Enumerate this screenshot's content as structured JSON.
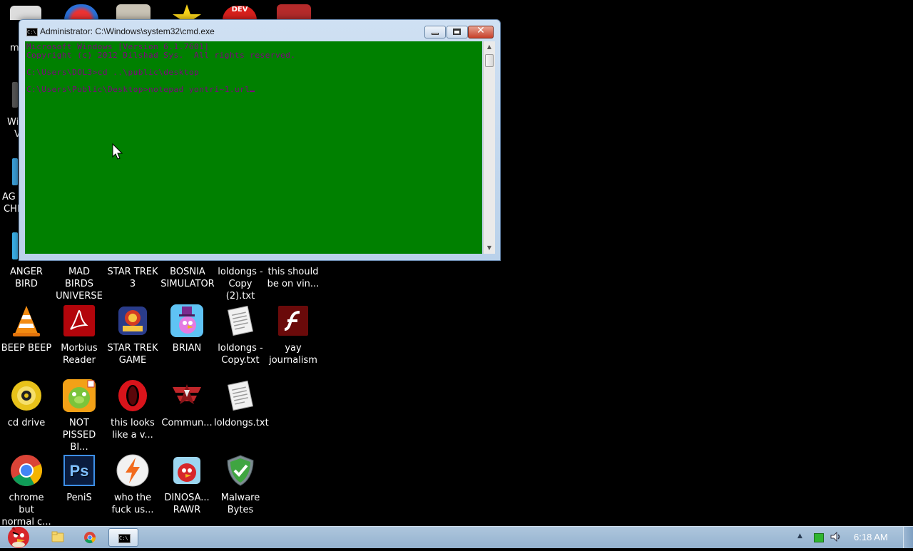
{
  "window": {
    "title": "Administrator: C:\\Windows\\system32\\cmd.exe",
    "console_lines": [
      "Microsoft Windows [Version 6.1.7601]",
      "Copyright (c) 2012 Dilshad Sys.  All rights reserved.",
      "C:\\Users\\DOL3>cd ..\\public\\desktop",
      "C:\\Users\\Public\\Desktop>notepad yontri~1.url"
    ],
    "console_bg": "#008000",
    "console_fg": "#800080"
  },
  "desktop": {
    "left_edge_labels": [
      "m",
      "Wi",
      "V",
      "AG",
      "CHI"
    ],
    "icons": [
      {
        "label": "ANGER\nBIRD",
        "icon": "orange-app-icon"
      },
      {
        "label": "MAD BIRDS\nUNIVERSE",
        "icon": "game-icon"
      },
      {
        "label": "STAR TREK\n3",
        "icon": "star-icon"
      },
      {
        "label": "BOSNIA\nSIMULATOR",
        "icon": "dev-icon"
      },
      {
        "label": "loldongs -\nCopy (2).txt",
        "icon": "text-file-icon"
      },
      {
        "label": "this should\nbe on vin...",
        "icon": "red-app-icon"
      },
      {
        "label": "BEEP BEEP",
        "icon": "vlc-cone-icon"
      },
      {
        "label": "Morbius\nReader",
        "icon": "pdf-reader-icon"
      },
      {
        "label": "STAR TREK\nGAME",
        "icon": "star-wars-game-icon"
      },
      {
        "label": "BRIAN",
        "icon": "bird-hat-icon"
      },
      {
        "label": "loldongs -\nCopy.txt",
        "icon": "text-file-icon"
      },
      {
        "label": "yay\njournalism",
        "icon": "flash-icon"
      },
      {
        "label": "cd drive",
        "icon": "cd-drive-icon"
      },
      {
        "label": "NOT\nPISSED BI...",
        "icon": "pig-game-icon"
      },
      {
        "label": "this looks\nlike a v...",
        "icon": "opera-icon"
      },
      {
        "label": "Commun...",
        "icon": "emblem-icon"
      },
      {
        "label": "loldongs.txt",
        "icon": "text-file-icon"
      },
      {
        "label": "chrome but\nnormal c...",
        "icon": "chrome-icon"
      },
      {
        "label": "PeniS",
        "icon": "photoshop-icon"
      },
      {
        "label": "who the\nfuck us...",
        "icon": "lightning-icon"
      },
      {
        "label": "DINOSA...\nRAWR",
        "icon": "angry-bird-icon"
      },
      {
        "label": "Malware\nBytes",
        "icon": "shield-icon"
      }
    ]
  },
  "taskbar": {
    "clock": "6:18 AM",
    "tray_icons": [
      "show-hidden-icons-arrow",
      "network-icon",
      "volume-icon"
    ],
    "pinned": [
      "start-angry-bird-icon",
      "explorer-folder-icon",
      "chrome-icon",
      "cmd-icon"
    ]
  }
}
